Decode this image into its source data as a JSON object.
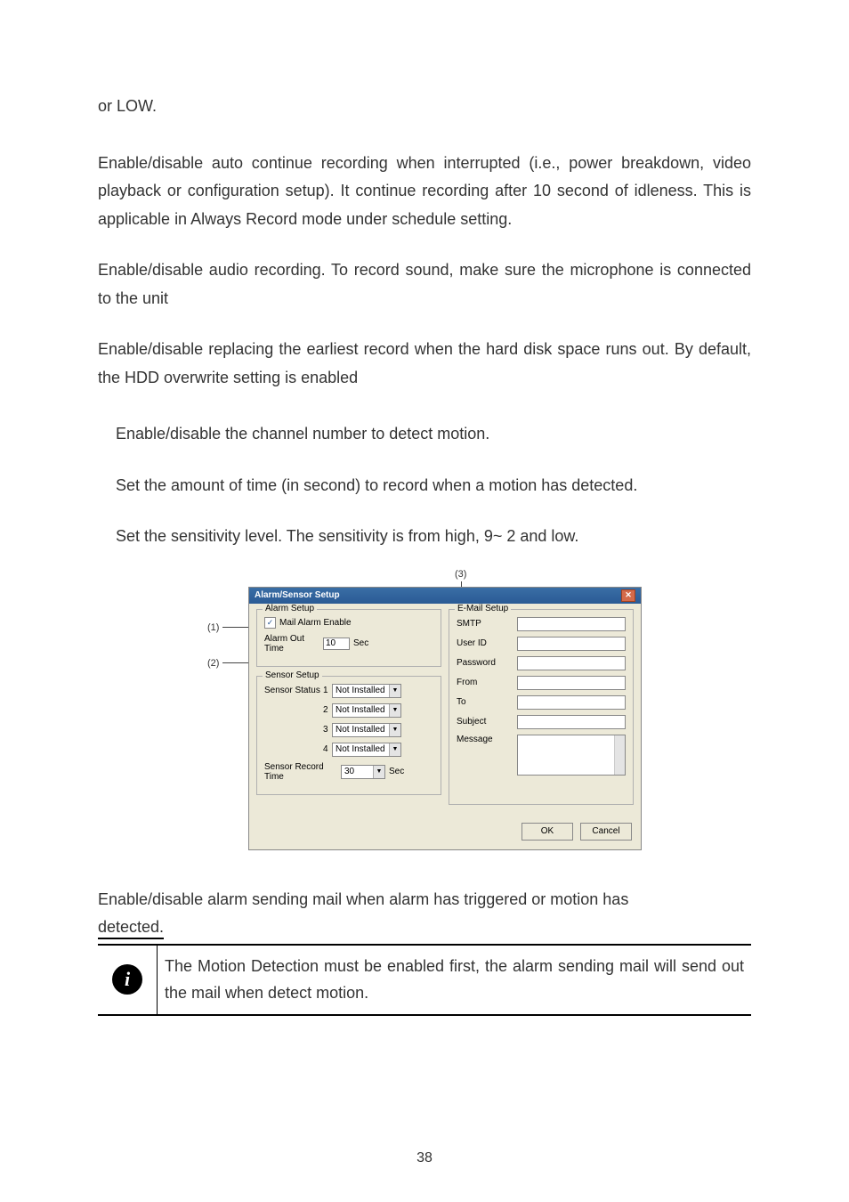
{
  "p_orlow": "or LOW.",
  "p_autocont": "Enable/disable auto continue recording when interrupted (i.e., power breakdown, video playback or configuration setup). It continue recording after 10 second of idleness. This is applicable in Always Record mode under schedule setting.",
  "p_audio": "Enable/disable audio recording. To record sound, make sure the microphone is connected to the unit",
  "p_overwrite": "Enable/disable replacing the earliest record when the hard disk space runs out. By default, the HDD overwrite setting is enabled",
  "p_motion1": "Enable/disable the channel number to detect motion.",
  "p_motion2": "Set the amount of time (in second) to record when a motion has detected.",
  "p_motion3": "Set the sensitivity level. The sensitivity is from high, 9~ 2 and low.",
  "p_mailalarm": "Enable/disable alarm sending mail when alarm has triggered or motion has ",
  "p_detected": "detected.",
  "note_text": "The Motion Detection must be enabled first, the alarm sending mail will send out the mail when detect motion.",
  "page_number": "38",
  "anno": {
    "a1": "(1)",
    "a2": "(2)",
    "a3": "(3)"
  },
  "dialog": {
    "title": "Alarm/Sensor Setup",
    "alarm_legend": "Alarm Setup",
    "mail_enable": "Mail Alarm Enable",
    "alarm_out_time": "Alarm Out Time",
    "alarm_out_val": "10",
    "sec": "Sec",
    "sensor_legend": "Sensor Setup",
    "sensor_status": "Sensor Status",
    "not_installed": "Not Installed",
    "s1": "1",
    "s2": "2",
    "s3": "3",
    "s4": "4",
    "sensor_record_time": "Sensor Record Time",
    "sensor_record_val": "30",
    "email_legend": "E-Mail Setup",
    "smtp": "SMTP",
    "userid": "User ID",
    "password": "Password",
    "from": "From",
    "to": "To",
    "subject": "Subject",
    "message": "Message",
    "ok": "OK",
    "cancel": "Cancel"
  }
}
